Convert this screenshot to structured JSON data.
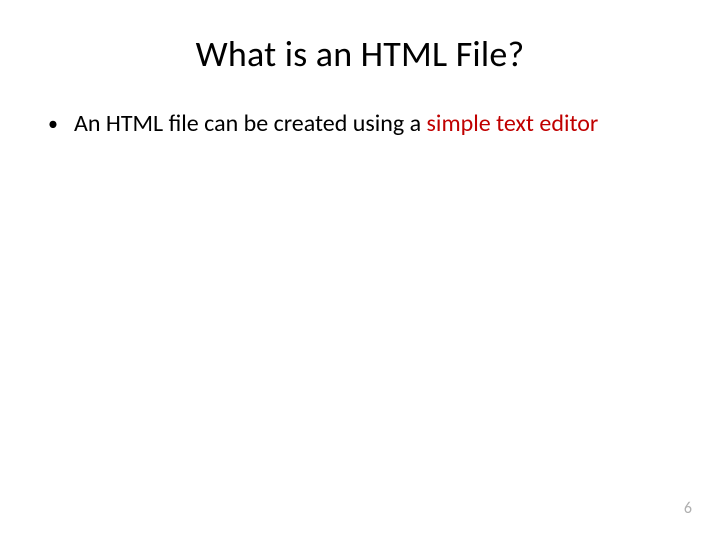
{
  "title": "What is an HTML File?",
  "bullet": {
    "text_prefix": "An HTML file can be created using a ",
    "highlight": "simple text editor"
  },
  "page_number": "6"
}
